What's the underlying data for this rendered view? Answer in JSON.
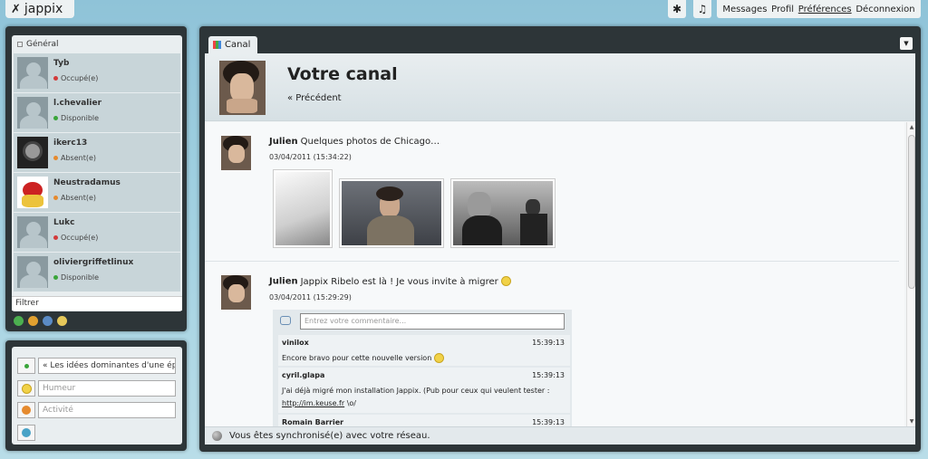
{
  "app": {
    "logo": "jappix"
  },
  "topbar": {
    "icon_button_1": "✱",
    "icon_button_2": "♫",
    "nav": [
      "Messages",
      "Profil",
      "Préférences",
      "Déconnexion"
    ]
  },
  "roster": {
    "group": "Général",
    "buddies": [
      {
        "name": "Tyb",
        "status": "Occupé(e)",
        "status_color": "#d23b3b"
      },
      {
        "name": "l.chevalier",
        "status": "Disponible",
        "status_color": "#3aa53a"
      },
      {
        "name": "ikerc13",
        "status": "Absent(e)",
        "status_color": "#e58a2e"
      },
      {
        "name": "Neustradamus",
        "status": "Absent(e)",
        "status_color": "#e58a2e"
      },
      {
        "name": "Lukc",
        "status": "Occupé(e)",
        "status_color": "#d23b3b"
      },
      {
        "name": "oliviergriffetlinux",
        "status": "Disponible",
        "status_color": "#3aa53a"
      }
    ],
    "filter_label": "Filtrer"
  },
  "status": {
    "message": "« Les idées dominantes d'une époque",
    "mood_placeholder": "Humeur",
    "activity_placeholder": "Activité"
  },
  "main": {
    "tab_label": "Canal",
    "title": "Votre canal",
    "previous": "« Précédent",
    "posts": [
      {
        "author": "Julien",
        "text": "Quelques photos de Chicago…",
        "time": "03/04/2011 (15:34:22)"
      },
      {
        "author": "Julien",
        "text": "Jappix Ribelo est là ! Je vous invite à migrer",
        "time": "03/04/2011 (15:29:29)"
      }
    ],
    "comment_placeholder": "Entrez votre commentaire...",
    "comments": [
      {
        "author": "vinilox",
        "time": "15:39:13",
        "text": "Encore bravo pour cette nouvelle version"
      },
      {
        "author": "cyril.glapa",
        "time": "15:39:13",
        "text": "J'ai déjà migré mon installation Jappix. (Pub pour ceux qui veulent tester :",
        "link": "http://im.keuse.fr",
        "after": " \\o/"
      },
      {
        "author": "Romain Barrier",
        "time": "15:39:13",
        "text": ""
      }
    ],
    "footer": "Vous êtes synchronisé(e) avec votre réseau."
  }
}
